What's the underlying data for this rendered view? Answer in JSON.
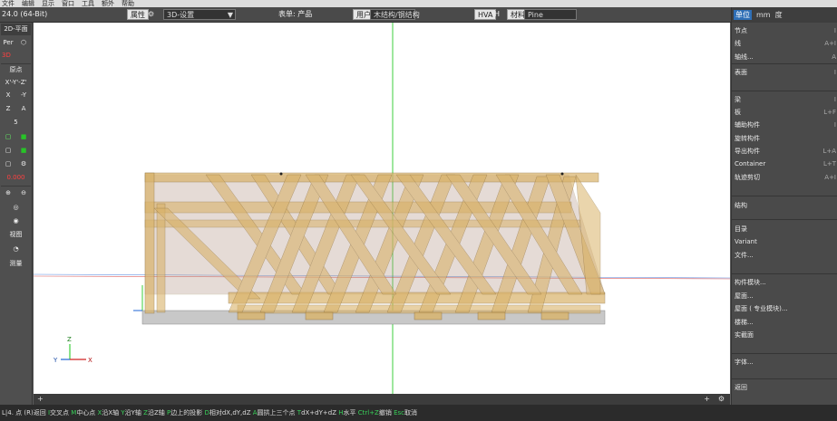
{
  "menubar": [
    "文件",
    "编辑",
    "显示",
    "窗口",
    "工具",
    "额外",
    "帮助"
  ],
  "toolbar": {
    "version": "24.0 (64-Bit)",
    "properties_btn": "属性",
    "view_select": "3D-设置",
    "dropdown_arrow": "▼",
    "layer_label": "表单: 产品",
    "user_btn": "用户",
    "structure_field": "木结构/钢结构",
    "hva_btn": "HVA",
    "h_label": "H",
    "material_btn": "材料",
    "material_value": "Pine"
  },
  "left": {
    "plan_2d": "2D-平面",
    "per": "Per",
    "red_label": "3D",
    "origin": "原点",
    "xyz": "X'-Y'-Z'",
    "x": "X",
    "neg_y": "-Y",
    "z": "Z",
    "a": "A",
    "five": "5",
    "view": "视图",
    "measure": "测量",
    "red_value": "0.000"
  },
  "right": {
    "tab_unit": "单位",
    "unit_mm": "mm",
    "unit_deg": "度",
    "items": [
      {
        "label": "节点",
        "shortcut": "I"
      },
      {
        "label": "线",
        "shortcut": "A+I"
      },
      {
        "label": "轴线...",
        "shortcut": "A"
      },
      {
        "label": "表面",
        "shortcut": "I"
      },
      {
        "label": "梁",
        "shortcut": "I"
      },
      {
        "label": "板",
        "shortcut": "L+F"
      },
      {
        "label": "辅助构件",
        "shortcut": "I"
      },
      {
        "label": "旋转构件",
        "shortcut": ""
      },
      {
        "label": "导出构件",
        "shortcut": "L+A"
      },
      {
        "label": "Container",
        "shortcut": "L+T"
      },
      {
        "label": "轨迹剪切",
        "shortcut": "A+I"
      },
      {
        "label": "结构",
        "shortcut": ""
      },
      {
        "label": "目录",
        "shortcut": ""
      },
      {
        "label": "Variant",
        "shortcut": ""
      },
      {
        "label": "文件...",
        "shortcut": ""
      },
      {
        "label": "构件模块...",
        "shortcut": ""
      },
      {
        "label": "屋面...",
        "shortcut": ""
      },
      {
        "label": "屋面 ( 专业模块)...",
        "shortcut": ""
      },
      {
        "label": "楼梯...",
        "shortcut": ""
      },
      {
        "label": "实截面",
        "shortcut": ""
      },
      {
        "label": "字体...",
        "shortcut": ""
      },
      {
        "label": "返回",
        "shortcut": ""
      }
    ]
  },
  "axes": {
    "x": "X",
    "y": "Y",
    "z": "Z"
  },
  "tabs": {
    "add": "+",
    "plus_right": "+"
  },
  "status": {
    "prefix": "L|4. 点 (R)返回",
    "hints": [
      {
        "key": "I",
        "text": "交叉点"
      },
      {
        "key": "M",
        "text": "中心点"
      },
      {
        "key": "X",
        "text": "沿X轴"
      },
      {
        "key": "Y",
        "text": "沿Y轴"
      },
      {
        "key": "Z",
        "text": "沿Z轴"
      },
      {
        "key": "P",
        "text": "边上的投影"
      },
      {
        "key": "D",
        "text": "相对dX,dY,dZ"
      },
      {
        "key": "A",
        "text": "圆拱上三个点"
      },
      {
        "key": "T",
        "text": "dX+dY+dZ"
      },
      {
        "key": "H",
        "text": "水平"
      },
      {
        "key": "Ctrl+Z",
        "text": "撤销"
      },
      {
        "key": "Esc",
        "text": "取消"
      }
    ]
  },
  "colors": {
    "wood": "#d9b36a",
    "wood_edge": "#8a6a33",
    "roof": "#b79a8c",
    "axis_green": "#3ccf3c",
    "axis_blue": "#1e63d6",
    "axis_red": "#d02020",
    "accent": "#2f6fb6"
  }
}
